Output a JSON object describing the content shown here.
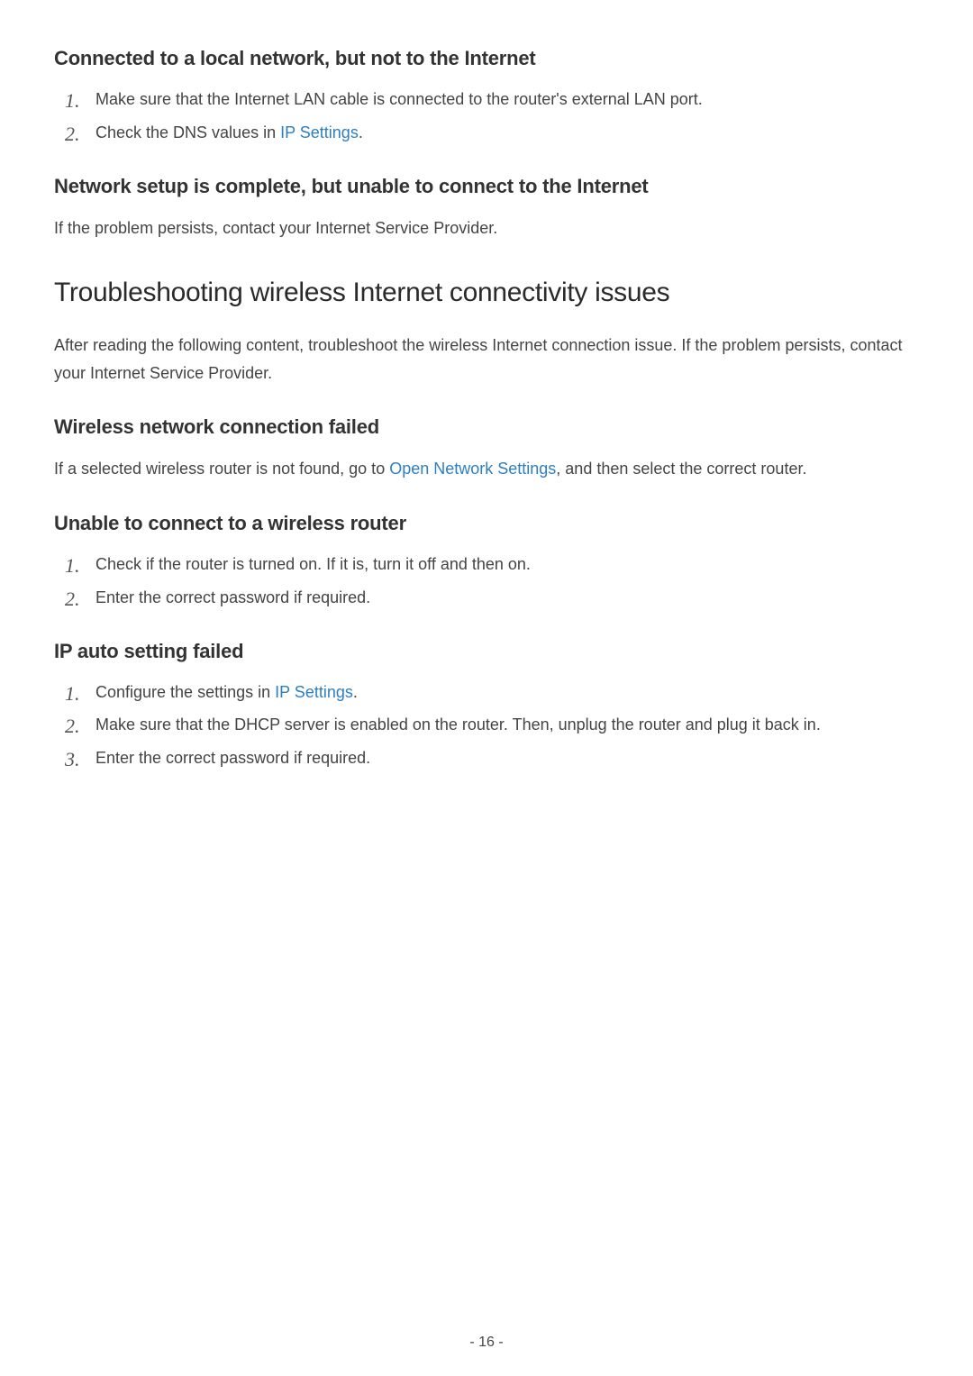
{
  "section1": {
    "heading": "Connected to a local network, but not to the Internet",
    "items": [
      {
        "num": "1.",
        "text": "Make sure that the Internet LAN cable is connected to the router's external LAN port."
      },
      {
        "num": "2.",
        "prefix": "Check the DNS values in ",
        "link": "IP Settings",
        "suffix": "."
      }
    ]
  },
  "section2": {
    "heading": "Network setup is complete, but unable to connect to the Internet",
    "body": "If the problem persists, contact your Internet Service Provider."
  },
  "section3": {
    "heading": "Troubleshooting wireless Internet connectivity issues",
    "body": "After reading the following content, troubleshoot the wireless Internet connection issue. If the problem persists, contact your Internet Service Provider."
  },
  "section4": {
    "heading": "Wireless network connection failed",
    "prefix": "If a selected wireless router is not found, go to ",
    "link": "Open Network Settings",
    "suffix": ", and then select the correct router."
  },
  "section5": {
    "heading": "Unable to connect to a wireless router",
    "items": [
      {
        "num": "1.",
        "text": "Check if the router is turned on. If it is, turn it off and then on."
      },
      {
        "num": "2.",
        "text": "Enter the correct password if required."
      }
    ]
  },
  "section6": {
    "heading": "IP auto setting failed",
    "items": [
      {
        "num": "1.",
        "prefix": "Configure the settings in ",
        "link": "IP Settings",
        "suffix": "."
      },
      {
        "num": "2.",
        "text": "Make sure that the DHCP server is enabled on the router. Then, unplug the router and plug it back in."
      },
      {
        "num": "3.",
        "text": "Enter the correct password if required."
      }
    ]
  },
  "pageNumber": "- 16 -"
}
